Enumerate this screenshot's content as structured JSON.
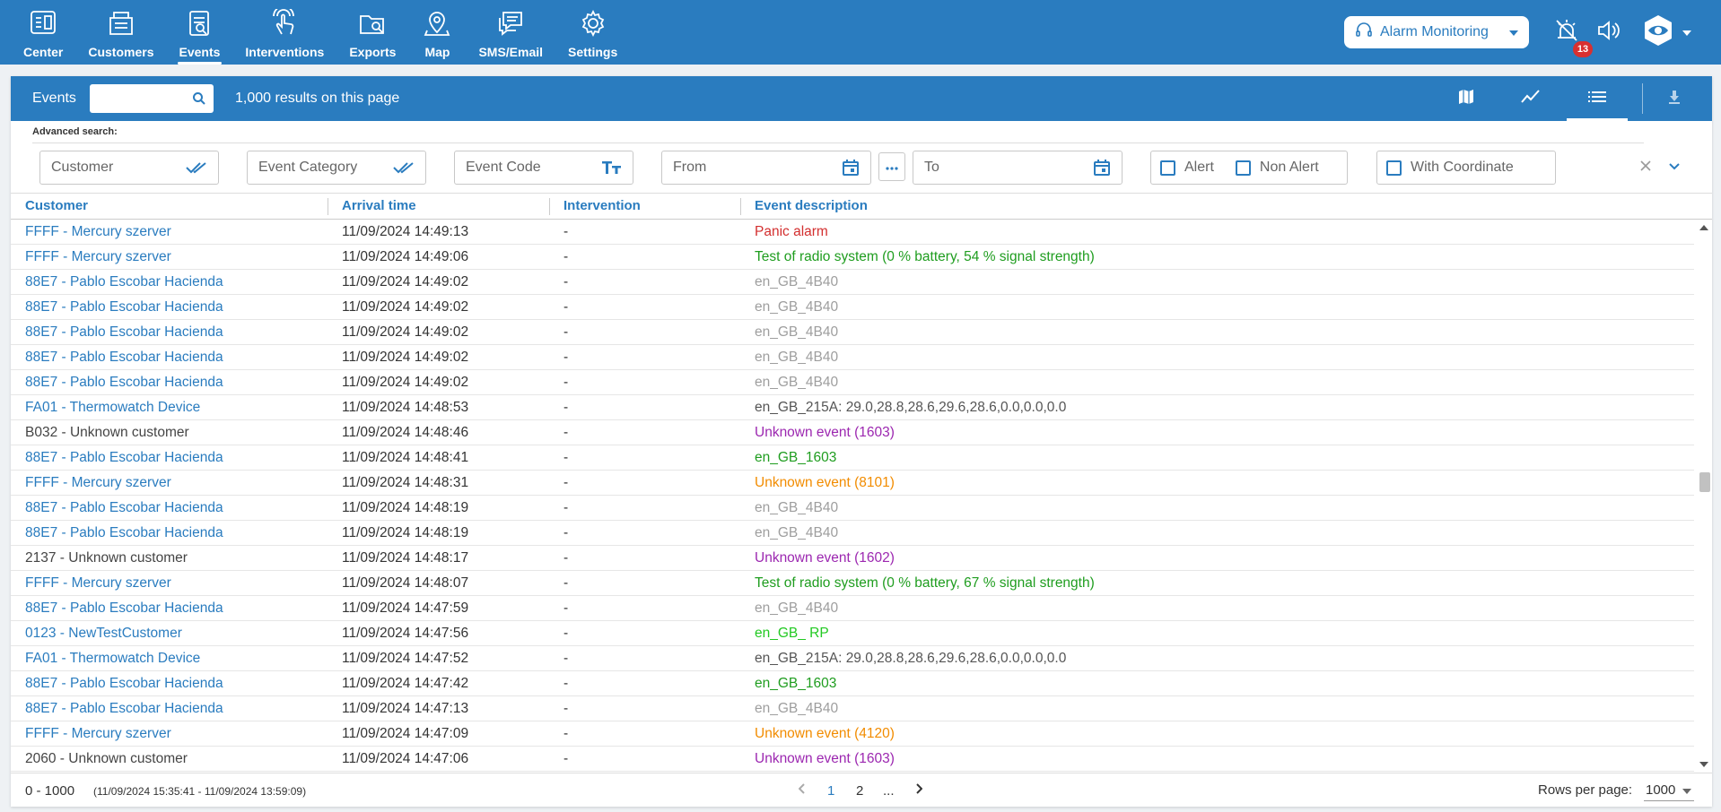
{
  "nav": {
    "items": [
      {
        "label": "Center",
        "icon": "center-icon"
      },
      {
        "label": "Customers",
        "icon": "customers-icon"
      },
      {
        "label": "Events",
        "icon": "events-icon",
        "active": true
      },
      {
        "label": "Interventions",
        "icon": "interventions-icon"
      },
      {
        "label": "Exports",
        "icon": "exports-icon"
      },
      {
        "label": "Map",
        "icon": "map-pin-icon"
      },
      {
        "label": "SMS/Email",
        "icon": "sms-email-icon"
      },
      {
        "label": "Settings",
        "icon": "settings-icon"
      }
    ]
  },
  "topright": {
    "alarm_label": "Alarm Monitoring",
    "badge_count": "13"
  },
  "panel": {
    "title": "Events",
    "search_placeholder": "",
    "result_count": "1,000 results on this page"
  },
  "filters": {
    "advanced_label": "Advanced search:",
    "customer": "Customer",
    "event_category": "Event Category",
    "event_code": "Event Code",
    "from": "From",
    "to": "To",
    "alert": "Alert",
    "non_alert": "Non Alert",
    "with_coordinate": "With Coordinate"
  },
  "table": {
    "columns": [
      "Customer",
      "Arrival time",
      "Intervention",
      "Event description"
    ],
    "rows": [
      {
        "customer": "FFFF - Mercury szerver",
        "time": "11/09/2024 14:49:13",
        "intervention": "-",
        "description": "Panic alarm",
        "desc_color": "#d32f2f",
        "cust_color": "#2a7cbf"
      },
      {
        "customer": "FFFF - Mercury szerver",
        "time": "11/09/2024 14:49:06",
        "intervention": "-",
        "description": "Test of radio system (0 % battery, 54 % signal strength)",
        "desc_color": "#1f9d1f",
        "cust_color": "#2a7cbf"
      },
      {
        "customer": "88E7 - Pablo Escobar Hacienda",
        "time": "11/09/2024 14:49:02",
        "intervention": "-",
        "description": "en_GB_4B40",
        "desc_color": "#9e9e9e",
        "cust_color": "#2a7cbf"
      },
      {
        "customer": "88E7 - Pablo Escobar Hacienda",
        "time": "11/09/2024 14:49:02",
        "intervention": "-",
        "description": "en_GB_4B40",
        "desc_color": "#9e9e9e",
        "cust_color": "#2a7cbf"
      },
      {
        "customer": "88E7 - Pablo Escobar Hacienda",
        "time": "11/09/2024 14:49:02",
        "intervention": "-",
        "description": "en_GB_4B40",
        "desc_color": "#9e9e9e",
        "cust_color": "#2a7cbf"
      },
      {
        "customer": "88E7 - Pablo Escobar Hacienda",
        "time": "11/09/2024 14:49:02",
        "intervention": "-",
        "description": "en_GB_4B40",
        "desc_color": "#9e9e9e",
        "cust_color": "#2a7cbf"
      },
      {
        "customer": "88E7 - Pablo Escobar Hacienda",
        "time": "11/09/2024 14:49:02",
        "intervention": "-",
        "description": "en_GB_4B40",
        "desc_color": "#9e9e9e",
        "cust_color": "#2a7cbf"
      },
      {
        "customer": "FA01 - Thermowatch Device",
        "time": "11/09/2024 14:48:53",
        "intervention": "-",
        "description": "en_GB_215A: 29.0,28.8,28.6,29.6,28.6,0.0,0.0,0.0",
        "desc_color": "#555555",
        "cust_color": "#2a7cbf"
      },
      {
        "customer": "B032 - Unknown customer",
        "time": "11/09/2024 14:48:46",
        "intervention": "-",
        "description": "Unknown event (1603)",
        "desc_color": "#9c27b0",
        "cust_color": "#444444"
      },
      {
        "customer": "88E7 - Pablo Escobar Hacienda",
        "time": "11/09/2024 14:48:41",
        "intervention": "-",
        "description": "en_GB_1603",
        "desc_color": "#1f9d1f",
        "cust_color": "#2a7cbf"
      },
      {
        "customer": "FFFF - Mercury szerver",
        "time": "11/09/2024 14:48:31",
        "intervention": "-",
        "description": "Unknown event (8101)",
        "desc_color": "#f28c00",
        "cust_color": "#2a7cbf"
      },
      {
        "customer": "88E7 - Pablo Escobar Hacienda",
        "time": "11/09/2024 14:48:19",
        "intervention": "-",
        "description": "en_GB_4B40",
        "desc_color": "#9e9e9e",
        "cust_color": "#2a7cbf"
      },
      {
        "customer": "88E7 - Pablo Escobar Hacienda",
        "time": "11/09/2024 14:48:19",
        "intervention": "-",
        "description": "en_GB_4B40",
        "desc_color": "#9e9e9e",
        "cust_color": "#2a7cbf"
      },
      {
        "customer": "2137 - Unknown customer",
        "time": "11/09/2024 14:48:17",
        "intervention": "-",
        "description": "Unknown event (1602)",
        "desc_color": "#9c27b0",
        "cust_color": "#444444"
      },
      {
        "customer": "FFFF - Mercury szerver",
        "time": "11/09/2024 14:48:07",
        "intervention": "-",
        "description": "Test of radio system (0 % battery, 67 % signal strength)",
        "desc_color": "#1f9d1f",
        "cust_color": "#2a7cbf"
      },
      {
        "customer": "88E7 - Pablo Escobar Hacienda",
        "time": "11/09/2024 14:47:59",
        "intervention": "-",
        "description": "en_GB_4B40",
        "desc_color": "#9e9e9e",
        "cust_color": "#2a7cbf"
      },
      {
        "customer": "0123 - NewTestCustomer",
        "time": "11/09/2024 14:47:56",
        "intervention": "-",
        "description": "en_GB_ RP",
        "desc_color": "#22c922",
        "cust_color": "#2a7cbf"
      },
      {
        "customer": "FA01 - Thermowatch Device",
        "time": "11/09/2024 14:47:52",
        "intervention": "-",
        "description": "en_GB_215A: 29.0,28.8,28.6,29.6,28.6,0.0,0.0,0.0",
        "desc_color": "#555555",
        "cust_color": "#2a7cbf"
      },
      {
        "customer": "88E7 - Pablo Escobar Hacienda",
        "time": "11/09/2024 14:47:42",
        "intervention": "-",
        "description": "en_GB_1603",
        "desc_color": "#1f9d1f",
        "cust_color": "#2a7cbf"
      },
      {
        "customer": "88E7 - Pablo Escobar Hacienda",
        "time": "11/09/2024 14:47:13",
        "intervention": "-",
        "description": "en_GB_4B40",
        "desc_color": "#9e9e9e",
        "cust_color": "#2a7cbf"
      },
      {
        "customer": "FFFF - Mercury szerver",
        "time": "11/09/2024 14:47:09",
        "intervention": "-",
        "description": "Unknown event (4120)",
        "desc_color": "#f28c00",
        "cust_color": "#2a7cbf"
      },
      {
        "customer": "2060 - Unknown customer",
        "time": "11/09/2024 14:47:06",
        "intervention": "-",
        "description": "Unknown event (1603)",
        "desc_color": "#9c27b0",
        "cust_color": "#444444"
      }
    ]
  },
  "footer": {
    "range": "0 - 1000",
    "dates": "(11/09/2024 15:35:41 - 11/09/2024 13:59:09)",
    "pages": [
      "1",
      "2",
      "..."
    ],
    "rows_per_page_label": "Rows per page:",
    "rows_per_page_value": "1000"
  },
  "colors": {
    "primary": "#2a7cbf",
    "badge": "#d93030"
  }
}
